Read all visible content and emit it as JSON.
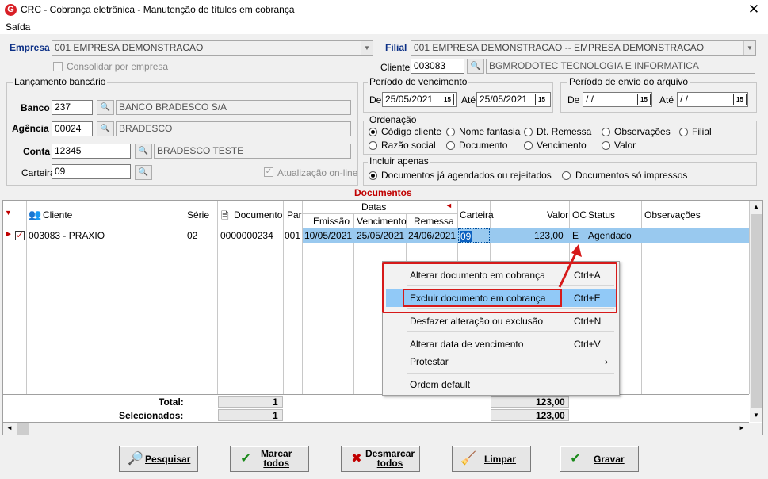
{
  "window": {
    "title": "CRC - Cobrança eletrônica - Manutenção de títulos em cobrança",
    "app_icon": "G"
  },
  "menu": {
    "saida": "Saída"
  },
  "empresa": {
    "label": "Empresa",
    "value": "001 EMPRESA DEMONSTRACAO",
    "consolidar": "Consolidar por empresa"
  },
  "filial": {
    "label": "Filial",
    "value": "001 EMPRESA DEMONSTRACAO -- EMPRESA DEMONSTRACAO"
  },
  "cliente": {
    "label": "Cliente",
    "code": "003083",
    "name": "BGMRODOTEC TECNOLOGIA  E INFORMATICA"
  },
  "lancamento": {
    "title": "Lançamento bancário",
    "banco_label": "Banco",
    "banco_code": "237",
    "banco_name": "BANCO BRADESCO S/A",
    "agencia_label": "Agência",
    "agencia_code": "00024",
    "agencia_name": "BRADESCO",
    "conta_label": "Conta",
    "conta_code": "12345",
    "conta_name": "BRADESCO TESTE",
    "carteira_label": "Carteira",
    "carteira_code": "09",
    "atualizacao": "Atualização on-line"
  },
  "periodo_venc": {
    "title": "Período de vencimento",
    "de_label": "De",
    "de": "25/05/2021",
    "ate_label": "Até",
    "ate": "25/05/2021"
  },
  "periodo_envio": {
    "title": "Período de envio do arquivo",
    "de_label": "De",
    "de": " / /",
    "ate_label": "Até",
    "ate": " / /"
  },
  "calendar_glyph": "15",
  "ordenacao": {
    "title": "Ordenação",
    "options": [
      "Código cliente",
      "Nome fantasia",
      "Dt. Remessa",
      "Observações",
      "Filial",
      "Razão social",
      "Documento",
      "Vencimento",
      "Valor"
    ],
    "selected": "Código cliente"
  },
  "incluir": {
    "title": "Incluir apenas",
    "options": [
      "Documentos já agendados ou rejeitados",
      "Documentos só impressos"
    ],
    "selected": "Documentos já agendados ou rejeitados"
  },
  "documentos": {
    "title": "Documentos",
    "headers": {
      "cliente": "Cliente",
      "serie": "Série",
      "documento": "Documento",
      "par": "Par",
      "datas": "Datas",
      "emissao": "Emissão",
      "vencimento": "Vencimento",
      "remessa": "Remessa",
      "carteira": "Carteira",
      "valor": "Valor",
      "oc": "OC",
      "status": "Status",
      "observacoes": "Observações"
    },
    "rows": [
      {
        "cliente": "003083 - PRAXIO",
        "serie": "02",
        "documento": "0000000234",
        "par": "001",
        "emissao": "10/05/2021",
        "vencimento": "25/05/2021",
        "remessa": "24/06/2021",
        "carteira": "09",
        "valor": "123,00",
        "oc": "E",
        "status": "Agendado",
        "observacoes": ""
      }
    ],
    "total_label": "Total:",
    "total_count": "1",
    "total_valor": "123,00",
    "selecionados_label": "Selecionados:",
    "selecionados_count": "1",
    "selecionados_valor": "123,00"
  },
  "context_menu": {
    "items": [
      {
        "label": "Alterar documento em cobrança",
        "shortcut": "Ctrl+A"
      },
      {
        "label": "Excluir documento em cobrança",
        "shortcut": "Ctrl+E",
        "highlighted": true
      },
      {
        "label": "Desfazer alteração ou exclusão",
        "shortcut": "Ctrl+N"
      },
      {
        "label": "Alterar data de vencimento",
        "shortcut": "Ctrl+V"
      },
      {
        "label": "Protestar",
        "shortcut": "›"
      },
      {
        "label": "Ordem default",
        "shortcut": ""
      }
    ]
  },
  "buttons": {
    "pesquisar": "Pesquisar",
    "marcar_1": "Marcar",
    "marcar_2": "todos",
    "desmarcar_1": "Desmarcar",
    "desmarcar_2": "todos",
    "limpar": "Limpar",
    "gravar": "Gravar"
  },
  "colors": {
    "highlight": "#99c9ef",
    "accent_red": "#c00000",
    "label_blue": "#0b2f86",
    "title_red": "#c00000"
  }
}
